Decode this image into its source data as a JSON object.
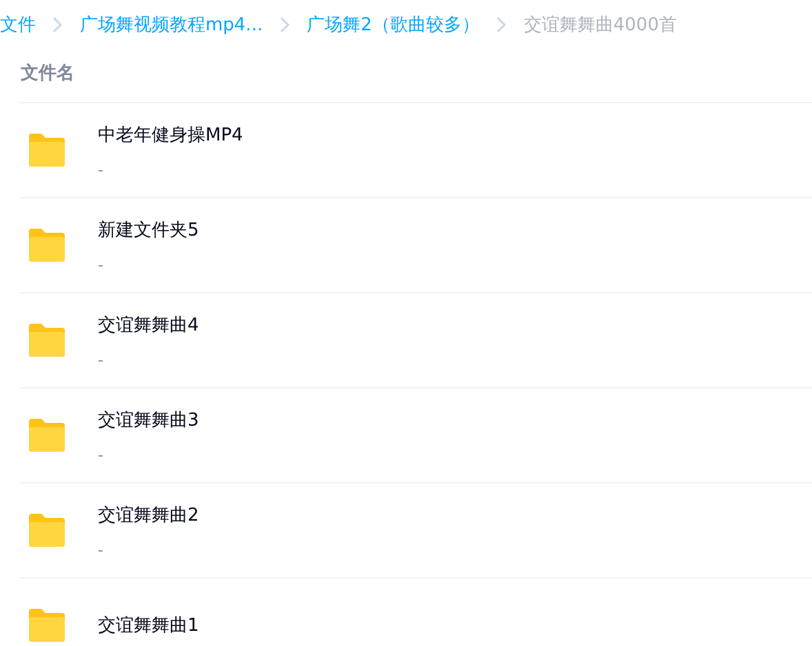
{
  "breadcrumb": [
    {
      "label": "文件",
      "current": false
    },
    {
      "label": "广场舞视频教程mp4...",
      "current": false
    },
    {
      "label": "广场舞2（歌曲较多）",
      "current": false
    },
    {
      "label": "交谊舞舞曲4000首",
      "current": true
    }
  ],
  "header": {
    "column_1": "文件名"
  },
  "rows": [
    {
      "name": "中老年健身操MP4",
      "meta": "-"
    },
    {
      "name": "新建文件夹5",
      "meta": "-"
    },
    {
      "name": "交谊舞舞曲4",
      "meta": "-"
    },
    {
      "name": "交谊舞舞曲3",
      "meta": "-"
    },
    {
      "name": "交谊舞舞曲2",
      "meta": "-"
    },
    {
      "name": "交谊舞舞曲1"
    }
  ]
}
